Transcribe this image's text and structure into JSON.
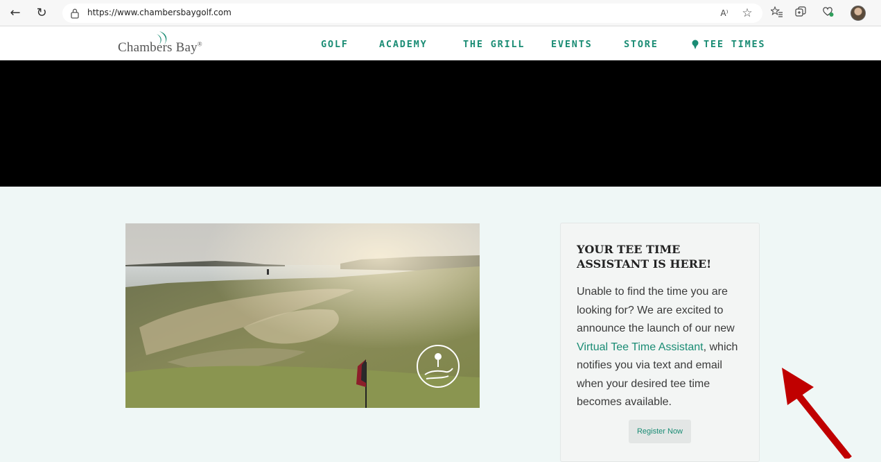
{
  "browser": {
    "url": "https://www.chambersbaygolf.com",
    "icons": [
      "back-arrow-icon",
      "refresh-icon",
      "lock-icon",
      "read-aloud-icon",
      "favorite-star-icon",
      "favorites-list-icon",
      "collections-icon",
      "extensions-icon",
      "profile-avatar-icon"
    ],
    "read_aloud_glyph": "A⁾",
    "back_glyph": "←",
    "refresh_glyph": "↻",
    "star_glyph": "☆",
    "favlist_glyph": "☆",
    "collections_glyph": "⧉",
    "ext_glyph": "⚙"
  },
  "site": {
    "logo_text": "Chambers Bay",
    "logo_reg": "®",
    "nav": [
      {
        "label": "GOLF"
      },
      {
        "label": "ACADEMY"
      },
      {
        "label": "THE GRILL"
      },
      {
        "label": "EVENTS"
      },
      {
        "label": "STORE"
      },
      {
        "label": "TEE TIMES"
      }
    ]
  },
  "assistant_card": {
    "title": "YOUR TEE TIME ASSISTANT IS HERE!",
    "body_before": "Unable to find the time you are looking for? We are excited to announce the launch of our new ",
    "link_text": "Virtual Tee Time Assistant",
    "body_after": ", which notifies you via text and email when your desired tee time becomes available.",
    "button_label": "Register Now"
  },
  "colors": {
    "accent": "#1a8c74",
    "page_bg": "#eff7f6",
    "hero_bg": "#000000",
    "arrow": "#c00000"
  }
}
